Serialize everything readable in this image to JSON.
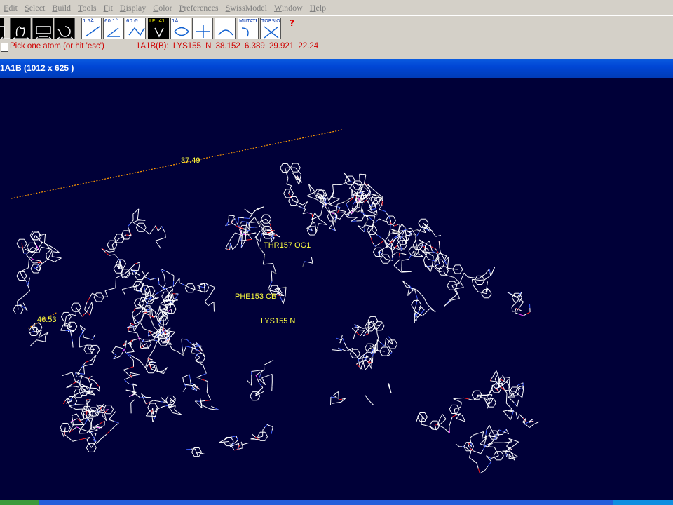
{
  "menu": [
    "Edit",
    "Select",
    "Build",
    "Tools",
    "Fit",
    "Display",
    "Color",
    "Preferences",
    "SwissModel",
    "Window",
    "Help"
  ],
  "toolbar": {
    "buttons": [
      {
        "name": "structure-tool",
        "icon": "structure-icon"
      },
      {
        "name": "move-tool",
        "icon": "hand-icon"
      },
      {
        "name": "translate-tool",
        "icon": "screen-icon"
      },
      {
        "name": "rotate-tool",
        "icon": "rotate-icon"
      },
      {
        "name": "distance-tool",
        "icon": "distance-icon",
        "label": "1.5Å"
      },
      {
        "name": "angle-tool",
        "icon": "angle-icon",
        "label": "60.1°"
      },
      {
        "name": "torsion-measure-tool",
        "icon": "dihedral-icon",
        "label": "60 Ø"
      },
      {
        "name": "identify-tool",
        "icon": "identify-icon",
        "label": "LEU41"
      },
      {
        "name": "view-tool",
        "icon": "eye-icon",
        "label": "1Å"
      },
      {
        "name": "center-tool",
        "icon": "center-icon"
      },
      {
        "name": "superpose-tool",
        "icon": "superpose-icon"
      },
      {
        "name": "mutate-tool",
        "icon": "mutate-icon",
        "label": "MUTATE"
      },
      {
        "name": "torsion-tool",
        "icon": "torsion-icon",
        "label": "TORSION"
      },
      {
        "name": "help-tool",
        "icon": "help-icon",
        "label": "?"
      }
    ]
  },
  "status": {
    "prompt": "Pick one atom (or hit 'esc')",
    "atom_info": "1A1B(B): LYS155   N    38.152   6.389  29.921    22.24"
  },
  "window": {
    "title": "1A1B  (1012 x 625 )"
  },
  "viewer": {
    "labels": [
      {
        "id": "dist1",
        "text": "37.49"
      },
      {
        "id": "dist2",
        "text": "46.53"
      },
      {
        "id": "thr",
        "text": "THR157  OG1"
      },
      {
        "id": "phe",
        "text": "PHE153  CB"
      },
      {
        "id": "lys",
        "text": "LYS155  N"
      }
    ],
    "colors": {
      "background": "#000038",
      "carbon": "#ffffff",
      "nitrogen": "#4060ff",
      "oxygen": "#ff2020",
      "sulfur": "#ff40ff",
      "label": "#ffff40",
      "distance": "#ff9900"
    }
  }
}
